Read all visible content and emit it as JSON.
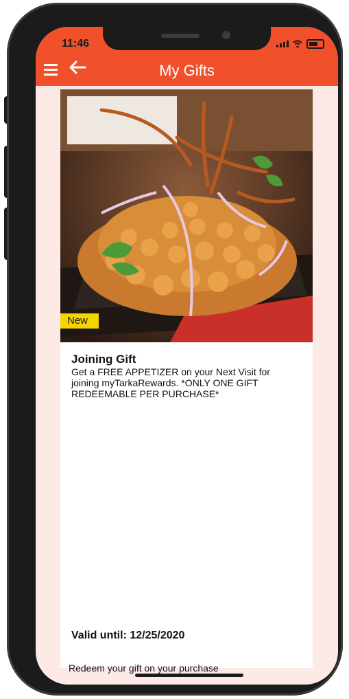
{
  "status_bar": {
    "time": "11:46"
  },
  "header": {
    "title": "My Gifts"
  },
  "gift": {
    "badge": "New",
    "title": "Joining Gift",
    "description": "Get a FREE APPETIZER on your Next Visit for joining myTarkaRewards. *ONLY ONE GIFT REDEEMABLE PER PURCHASE*",
    "valid_until": "Valid until: 12/25/2020",
    "redeem_note": "Redeem your gift on your purchase"
  },
  "colors": {
    "header": "#f0512a",
    "screen_bg": "#fde9e6",
    "badge": "#f5d400"
  },
  "icons": [
    "menu-icon",
    "back-arrow-icon",
    "signal-icon",
    "wifi-icon",
    "battery-icon"
  ]
}
